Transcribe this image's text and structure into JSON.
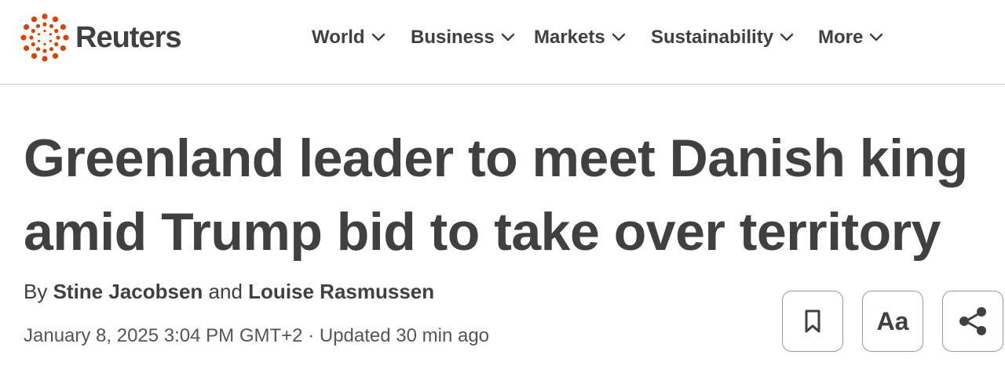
{
  "brand": {
    "name": "Reuters",
    "accent_color": "#dc4300",
    "text_color": "#404040"
  },
  "nav": {
    "items": [
      {
        "label": "World",
        "icon": "chevron-down-icon"
      },
      {
        "label": "Business",
        "icon": "chevron-down-icon"
      },
      {
        "label": "Markets",
        "icon": "chevron-down-icon"
      },
      {
        "label": "Sustainability",
        "icon": "chevron-down-icon"
      },
      {
        "label": "More",
        "icon": "chevron-down-icon"
      }
    ]
  },
  "article": {
    "headline": "Greenland leader to meet Danish king amid Trump bid to take over territory",
    "byline_prefix": "By",
    "author_1": "Stine Jacobsen",
    "byline_conjunction": "and",
    "author_2": "Louise Rasmussen",
    "date": "January 8, 2025 3:04 PM GMT+2",
    "separator": "·",
    "updated": "Updated 30 min ago"
  },
  "tools": {
    "bookmark_icon": "bookmark-icon",
    "text_size_label": "Aa",
    "share_icon": "share-icon"
  }
}
